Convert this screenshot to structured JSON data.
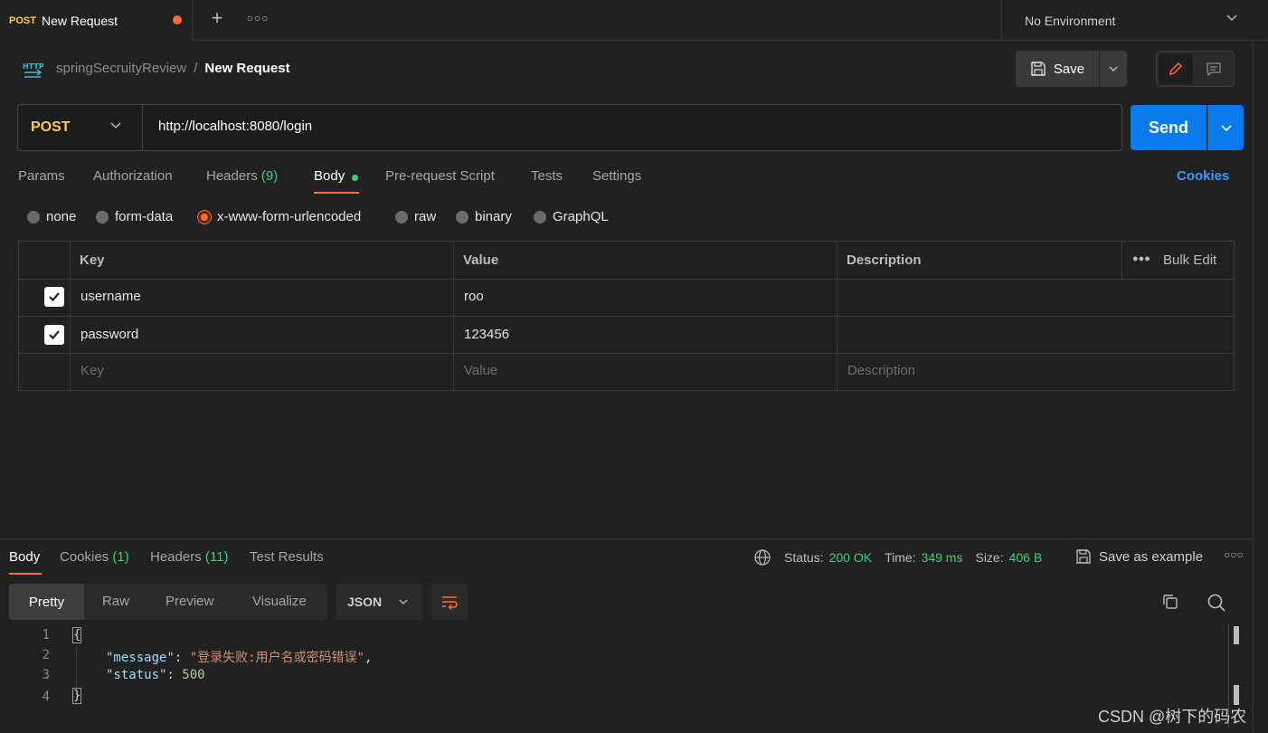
{
  "tabs": {
    "active": {
      "method": "POST",
      "title": "New Request"
    },
    "environment": "No Environment"
  },
  "breadcrumb": {
    "collection": "springSecruityReview",
    "separator": "/",
    "request": "New Request"
  },
  "toolbar": {
    "save_label": "Save"
  },
  "request": {
    "method": "POST",
    "url": "http://localhost:8080/login",
    "send_label": "Send",
    "tabs": [
      {
        "label": "Params"
      },
      {
        "label": "Authorization"
      },
      {
        "label": "Headers",
        "count": "(9)"
      },
      {
        "label": "Body"
      },
      {
        "label": "Pre-request Script"
      },
      {
        "label": "Tests"
      },
      {
        "label": "Settings"
      }
    ],
    "cookies_label": "Cookies",
    "body_types": [
      "none",
      "form-data",
      "x-www-form-urlencoded",
      "raw",
      "binary",
      "GraphQL"
    ],
    "selected_body_type": "x-www-form-urlencoded",
    "table": {
      "headers": {
        "key": "Key",
        "value": "Value",
        "description": "Description",
        "bulk_edit": "Bulk Edit"
      },
      "rows": [
        {
          "key": "username",
          "value": "roo",
          "description": ""
        },
        {
          "key": "password",
          "value": "123456",
          "description": ""
        }
      ],
      "placeholder": {
        "key": "Key",
        "value": "Value",
        "description": "Description"
      }
    }
  },
  "response": {
    "tabs": [
      {
        "label": "Body"
      },
      {
        "label": "Cookies",
        "count": "(1)"
      },
      {
        "label": "Headers",
        "count": "(11)"
      },
      {
        "label": "Test Results"
      }
    ],
    "status_label": "Status:",
    "status_value": "200 OK",
    "time_label": "Time:",
    "time_value": "349 ms",
    "size_label": "Size:",
    "size_value": "406 B",
    "save_example": "Save as example",
    "views": [
      "Pretty",
      "Raw",
      "Preview",
      "Visualize"
    ],
    "format": "JSON",
    "code": {
      "line_numbers": [
        "1",
        "2",
        "3",
        "4"
      ],
      "open_brace": "{",
      "close_brace": "}",
      "message_key": "\"message\"",
      "message_value": "\"登录失败:用户名或密码错误\"",
      "status_key": "\"status\"",
      "status_value": "500"
    }
  },
  "watermark": "CSDN @树下的码农",
  "colors": {
    "accent": "#ff6c37",
    "send": "#097bed",
    "method": "#ffcc4d",
    "success": "#3fcf7a",
    "link": "#3d9bff"
  }
}
